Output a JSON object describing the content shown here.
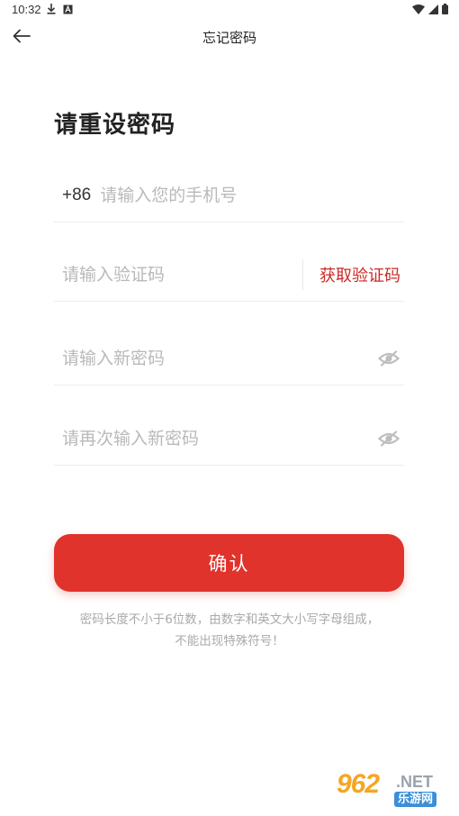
{
  "status_bar": {
    "time": "10:32",
    "left_icons": [
      "download-icon",
      "notification-a-icon"
    ],
    "right_icons": [
      "wifi-icon",
      "signal-icon",
      "battery-icon"
    ]
  },
  "nav": {
    "title": "忘记密码",
    "back_icon": "arrow-left-icon"
  },
  "heading": "请重设密码",
  "form": {
    "phone": {
      "country_code": "+86",
      "placeholder": "请输入您的手机号",
      "value": ""
    },
    "code": {
      "placeholder": "请输入验证码",
      "value": "",
      "get_code_label": "获取验证码"
    },
    "new_password": {
      "placeholder": "请输入新密码",
      "value": "",
      "icon": "eye-off-icon"
    },
    "confirm_password": {
      "placeholder": "请再次输入新密码",
      "value": "",
      "icon": "eye-off-icon"
    }
  },
  "confirm_button": "确认",
  "hint": {
    "line1": "密码长度不小于6位数，由数字和英文大小写字母组成，",
    "line2": "不能出现特殊符号！"
  },
  "watermark": {
    "number": "962",
    "suffix": ".NET",
    "sub": "乐游网"
  },
  "colors": {
    "accent": "#e0332b",
    "link_red": "#cc2a26",
    "placeholder": "#b9b9b9",
    "hint": "#a9a9a9",
    "divider": "#ececec"
  }
}
